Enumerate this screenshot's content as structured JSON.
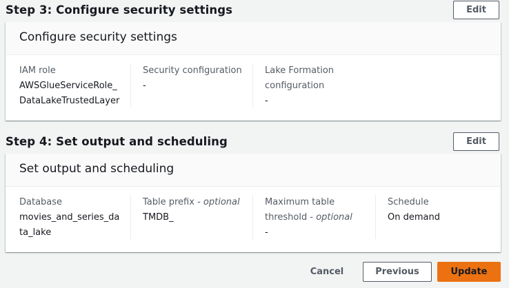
{
  "step3": {
    "title": "Step 3: Configure security settings",
    "edit_label": "Edit",
    "card_title": "Configure security settings",
    "fields": [
      {
        "label": "IAM role",
        "optional": "",
        "value": "AWSGlueServiceRole_\nDataLakeTrustedLayer"
      },
      {
        "label": "Security configuration",
        "optional": "",
        "value": "-"
      },
      {
        "label": "Lake Formation\nconfiguration",
        "optional": "",
        "value": "-"
      }
    ]
  },
  "step4": {
    "title": "Step 4: Set output and scheduling",
    "edit_label": "Edit",
    "card_title": "Set output and scheduling",
    "fields": [
      {
        "label": "Database",
        "optional": "",
        "value": "movies_and_series_da\nta_lake"
      },
      {
        "label": "Table prefix - ",
        "optional": "optional",
        "value": "TMDB_"
      },
      {
        "label": "Maximum table\nthreshold - ",
        "optional": "optional",
        "value": "-"
      },
      {
        "label": "Schedule",
        "optional": "",
        "value": "On demand"
      }
    ]
  },
  "footer": {
    "cancel_label": "Cancel",
    "previous_label": "Previous",
    "update_label": "Update"
  },
  "colors": {
    "primary_button": "#ec7211",
    "page_background": "#f2f3f3"
  }
}
